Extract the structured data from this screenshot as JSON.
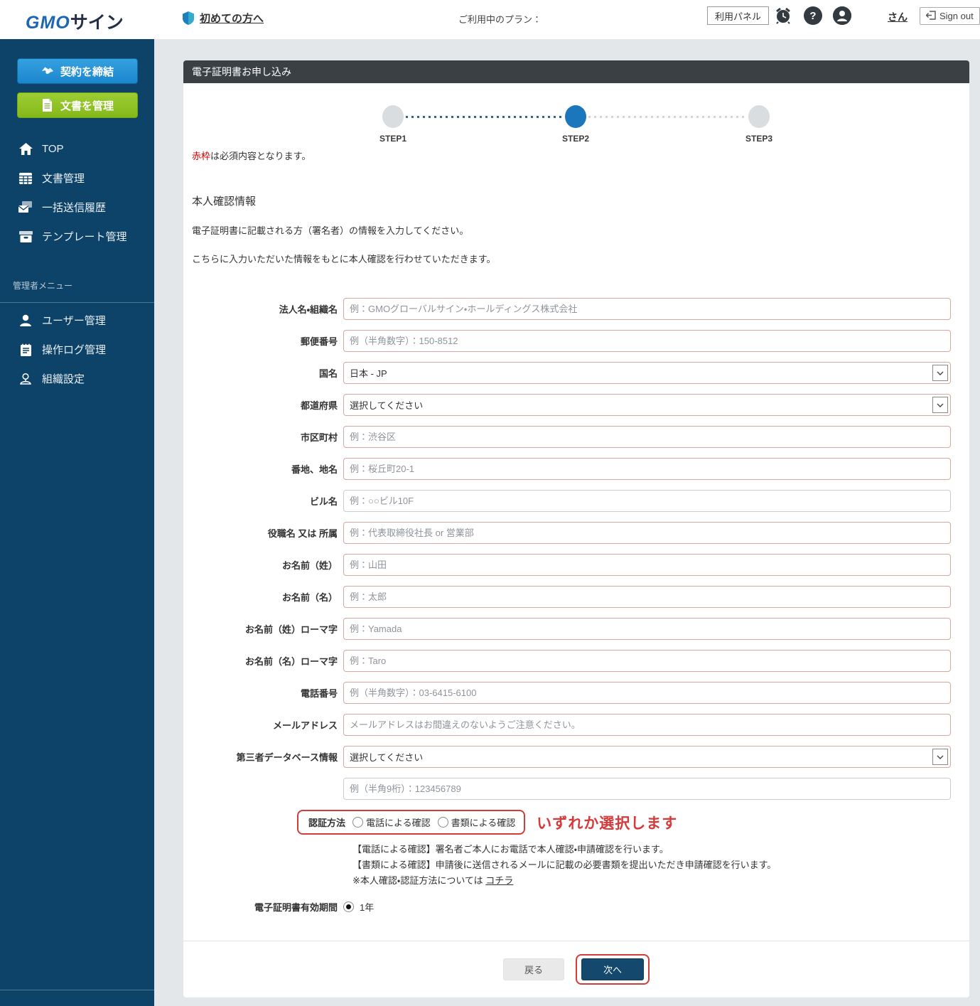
{
  "header": {
    "logo_gmo": "GMO",
    "logo_sign": "サイン",
    "beginner_link": "初めての方へ",
    "plan_label": "ご利用中のプラン：",
    "panel_button": "利用パネル",
    "help_icon_glyph": "?",
    "user_suffix": "さん",
    "signout_label": "Sign out"
  },
  "sidebar": {
    "conclude_button": "契約を締結",
    "manage_button": "文書を管理",
    "items": [
      {
        "id": "top",
        "icon": "home-icon",
        "label": "TOP"
      },
      {
        "id": "documents",
        "icon": "document-grid-icon",
        "label": "文書管理"
      },
      {
        "id": "bulk-send-history",
        "icon": "bulk-send-icon",
        "label": "一括送信履歴"
      },
      {
        "id": "template-management",
        "icon": "template-box-icon",
        "label": "テンプレート管理"
      }
    ],
    "admin_label": "管理者メニュー",
    "admin_items": [
      {
        "id": "user-management",
        "icon": "user-icon",
        "label": "ユーザー管理"
      },
      {
        "id": "operation-log",
        "icon": "log-notepad-icon",
        "label": "操作ログ管理"
      },
      {
        "id": "organization-settings",
        "icon": "organization-icon",
        "label": "組織設定"
      }
    ]
  },
  "page": {
    "title": "電子証明書お申し込み",
    "steps": {
      "labels": [
        "STEP1",
        "STEP2",
        "STEP3"
      ],
      "active": "STEP2"
    },
    "required_note": {
      "red": "赤枠",
      "rest": "は必須内容となります。"
    },
    "section": {
      "title": "本人確認情報",
      "desc1": "電子証明書に記載される方（署名者）の情報を入力してください。",
      "desc2": "こちらに入力いただいた情報をもとに本人確認を行わせていただきます。"
    },
    "fields": [
      {
        "id": "corporate-name",
        "label": "法人名・組織名",
        "type": "text",
        "placeholder": "例：GMOグローバルサイン・ホールディングス株式会社",
        "required": true
      },
      {
        "id": "postal-code",
        "label": "郵便番号",
        "type": "text",
        "placeholder": "例（半角数字）：150-8512",
        "required": true
      },
      {
        "id": "country",
        "label": "国名",
        "type": "select",
        "value": "日本 - JP",
        "required": true
      },
      {
        "id": "prefecture",
        "label": "都道府県",
        "type": "select",
        "value": "選択してください",
        "required": true
      },
      {
        "id": "city",
        "label": "市区町村",
        "type": "text",
        "placeholder": "例：渋谷区",
        "required": true
      },
      {
        "id": "street-address",
        "label": "番地、地名",
        "type": "text",
        "placeholder": "例：桜丘町20-1",
        "required": true
      },
      {
        "id": "building-name",
        "label": "ビル名",
        "type": "text",
        "placeholder": "例：○○ビル10F",
        "required": false
      },
      {
        "id": "title-or-department",
        "label": "役職名 又は 所属",
        "type": "text",
        "placeholder": "例：代表取締役社長 or 営業部",
        "required": true
      },
      {
        "id": "last-name",
        "label": "お名前（姓）",
        "type": "text",
        "placeholder": "例：山田",
        "required": true
      },
      {
        "id": "first-name",
        "label": "お名前（名）",
        "type": "text",
        "placeholder": "例：太郎",
        "required": true
      },
      {
        "id": "last-name-roman",
        "label": "お名前（姓）ローマ字",
        "type": "text",
        "placeholder": "例：Yamada",
        "required": true
      },
      {
        "id": "first-name-roman",
        "label": "お名前（名）ローマ字",
        "type": "text",
        "placeholder": "例：Taro",
        "required": true
      },
      {
        "id": "phone-number",
        "label": "電話番号",
        "type": "text",
        "placeholder": "例（半角数字）：03-6415-6100",
        "required": true
      },
      {
        "id": "email-address",
        "label": "メールアドレス",
        "type": "text",
        "placeholder": "メールアドレスはお間違えのないようご注意ください。",
        "required": true
      },
      {
        "id": "third-party-db",
        "label": "第三者データベース情報",
        "type": "select",
        "value": "選択してください",
        "required": true
      },
      {
        "id": "third-party-db-number",
        "label": "",
        "type": "text",
        "placeholder": "例（半角9桁）：123456789",
        "required": false
      }
    ],
    "auth": {
      "label": "認証方法",
      "options": [
        "電話による確認",
        "書類による確認"
      ],
      "annotation": "いずれか選択します"
    },
    "notes": [
      "【電話による確認】署名者ご本人にお電話で本人確認・申請確認を行います。",
      "【書類による確認】申請後に送信されるメールに記載の必要書類を提出いただき申請確認を行います。"
    ],
    "note_link": {
      "prefix": "※本人確認・認証方法については ",
      "link": "コチラ"
    },
    "validity": {
      "label": "電子証明書有効期間",
      "value": "1年",
      "checked": true
    },
    "footer": {
      "back": "戻る",
      "next": "次へ"
    }
  },
  "colors": {
    "sidebar_bg": "#0d4369",
    "conclude_blue": "#1b86cd",
    "manage_green": "#8dc21e",
    "titlebar_dark": "#3b4045",
    "step_active_blue": "#1b76bc",
    "required_border_pink": "#d9a7a2",
    "annotation_red": "#cf3d3d",
    "next_button_navy": "#15486d"
  }
}
